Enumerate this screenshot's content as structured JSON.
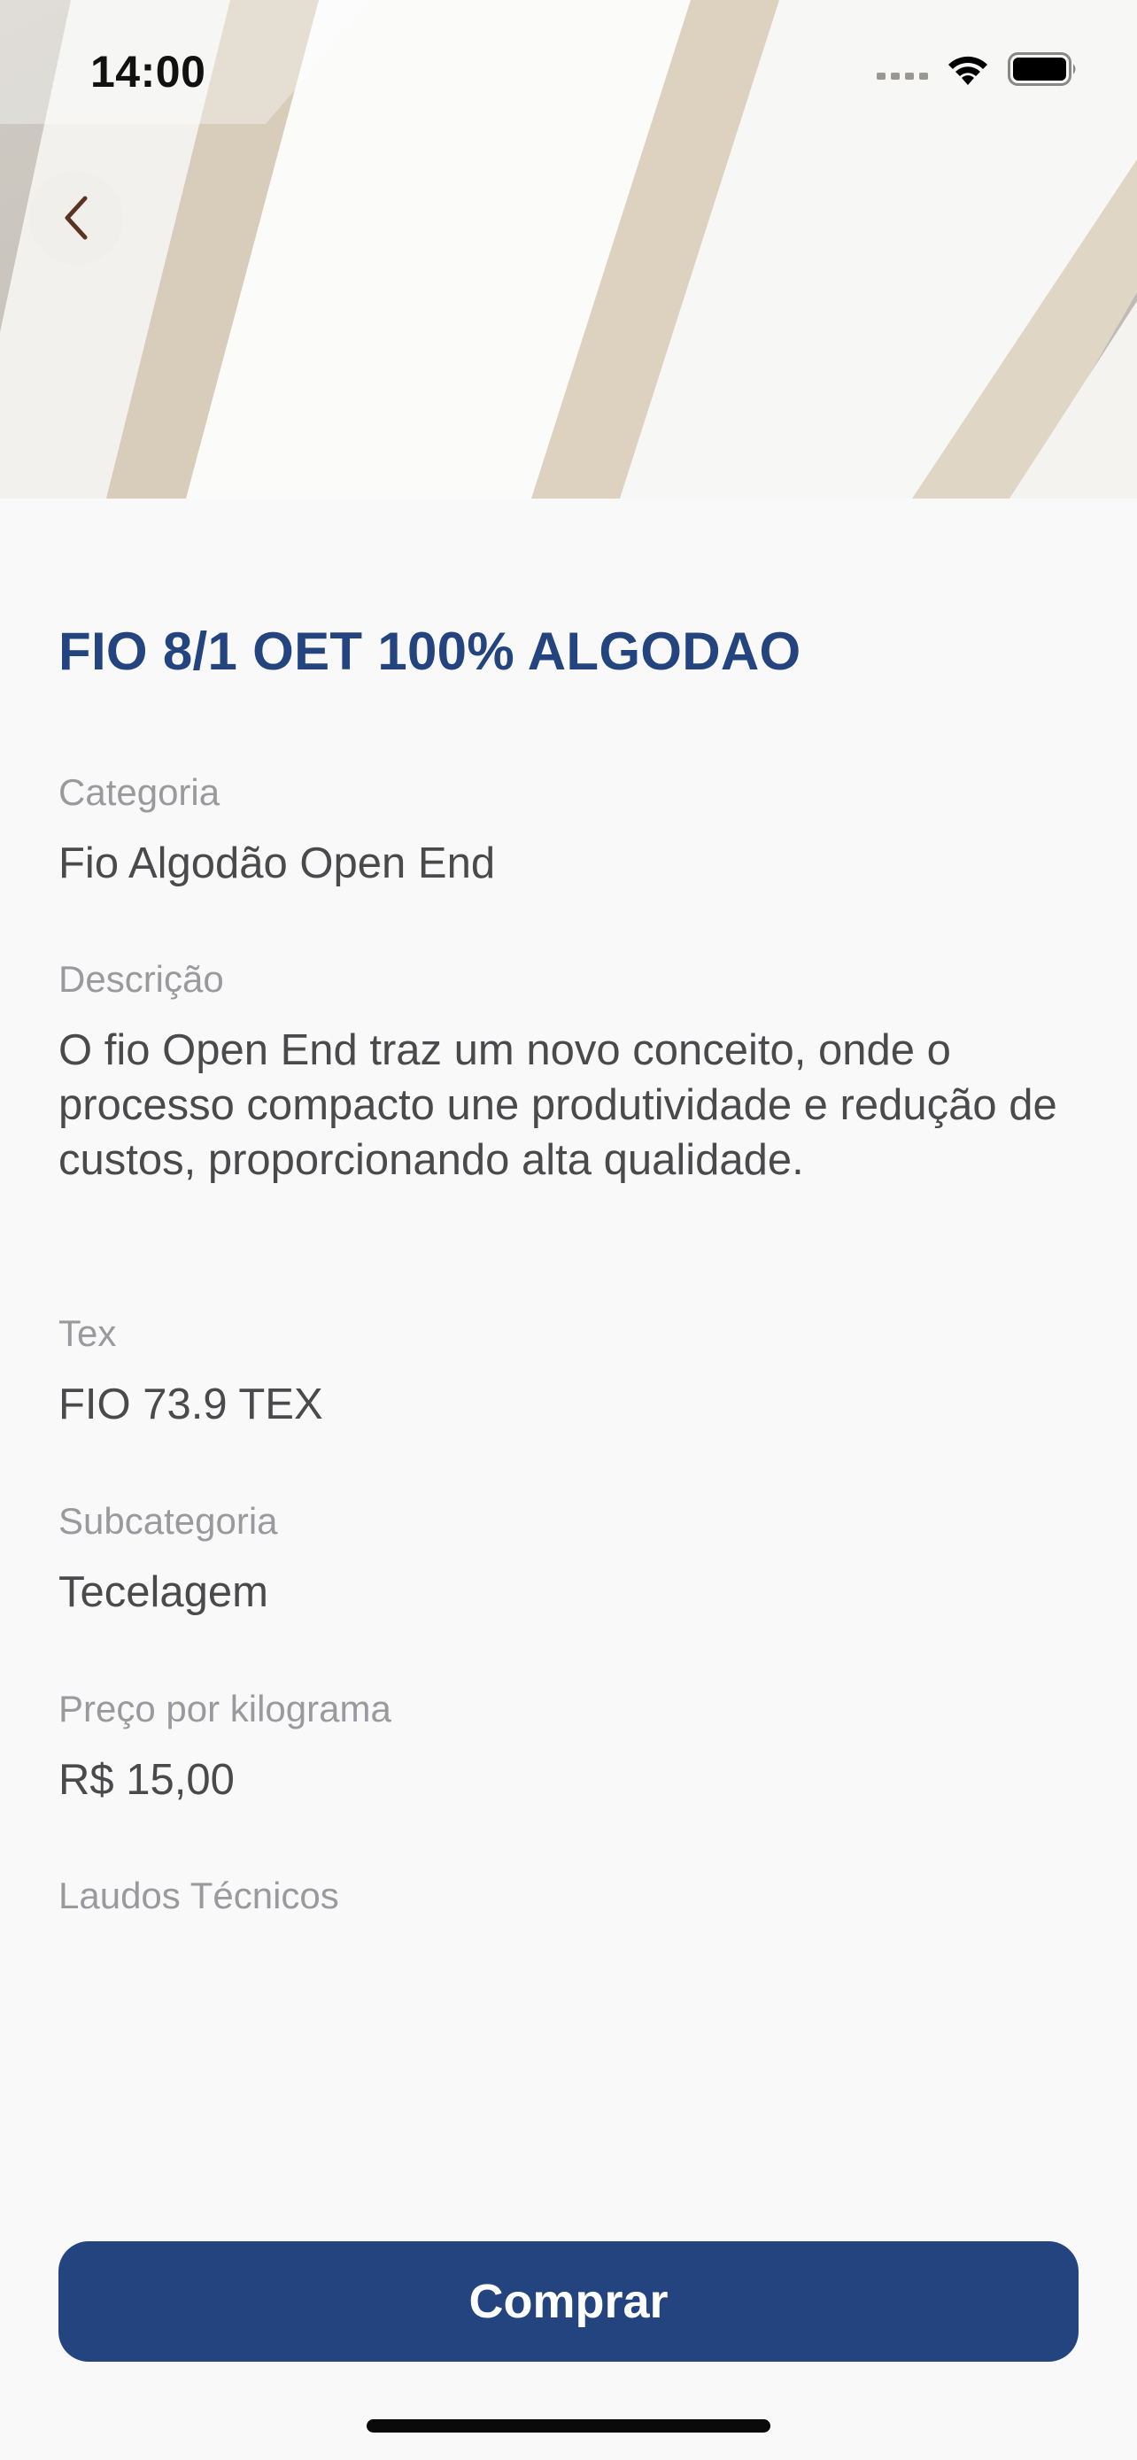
{
  "status_bar": {
    "time": "14:00",
    "icons": [
      "cellular-signal-icon",
      "wifi-icon",
      "battery-icon"
    ]
  },
  "nav": {
    "back_icon": "chevron-left-icon"
  },
  "hero": {
    "image": "cotton-yarn-spools-photo"
  },
  "product": {
    "title": "FIO 8/1 OET 100% ALGODAO",
    "fields": [
      {
        "label": "Categoria",
        "value": "Fio Algodão Open End"
      },
      {
        "label": "Descrição",
        "value": "O fio Open End traz um novo conceito, onde o processo compacto une produtividade e redução de custos, proporcionando alta qualidade."
      },
      {
        "label": "Tex",
        "value": "FIO 73.9 TEX"
      },
      {
        "label": "Subcategoria",
        "value": "Tecelagem"
      },
      {
        "label": "Preço por kilograma",
        "value": "R$ 15,00"
      },
      {
        "label": "Laudos Técnicos",
        "value": ""
      }
    ]
  },
  "actions": {
    "buy_label": "Comprar"
  },
  "colors": {
    "accent": "#23447f",
    "background": "#f9f9f9",
    "label": "#9a9a9e",
    "value": "#4a4a4c"
  }
}
